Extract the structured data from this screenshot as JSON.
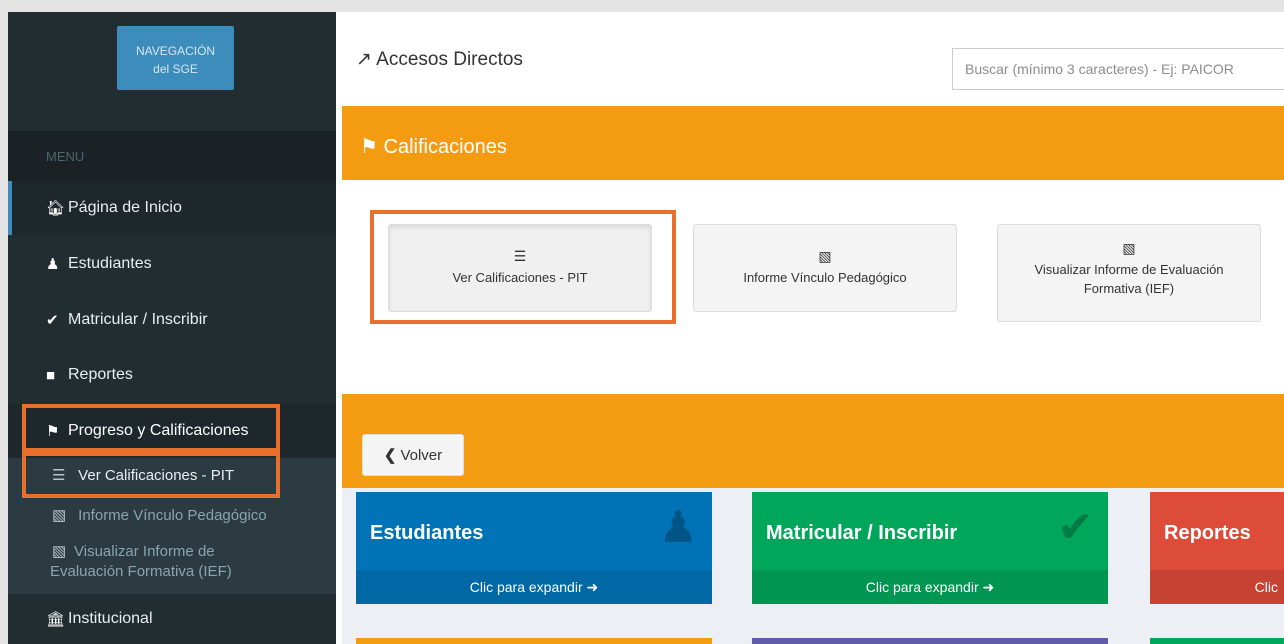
{
  "sidebar": {
    "nav_button": [
      "NAVEGACIÓN",
      "del SGE"
    ],
    "menu_header": "MENU",
    "items": [
      {
        "label": "Página de Inicio",
        "icon": "home-icon"
      },
      {
        "label": "Estudiantes",
        "icon": "person-icon"
      },
      {
        "label": "Matricular / Inscribir",
        "icon": "check-icon"
      },
      {
        "label": "Reportes",
        "icon": "file-icon"
      },
      {
        "label": "Progreso y Calificaciones",
        "icon": "flag-icon"
      },
      {
        "label": "Institucional",
        "icon": "institution-icon"
      }
    ],
    "subitems": [
      {
        "label": "Ver Calificaciones - PIT",
        "icon": "list-icon"
      },
      {
        "label": "Informe Vínculo Pedagógico",
        "icon": "book-icon"
      },
      {
        "label_line1": "Visualizar Informe de",
        "label_line2": "Evaluación Formativa (IEF)",
        "icon": "book-icon"
      }
    ]
  },
  "header": {
    "title": "Accesos Directos",
    "search_placeholder": "Buscar (mínimo 3 caracteres) - Ej: PAICOR"
  },
  "calificaciones": {
    "title": "Calificaciones",
    "shortcuts": [
      {
        "label": "Ver Calificaciones - PIT",
        "icon": "list-icon"
      },
      {
        "label": "Informe Vínculo Pedagógico",
        "icon": "book-icon"
      },
      {
        "label_line1": "Visualizar Informe de Evaluación",
        "label_line2": "Formativa (IEF)",
        "icon": "book-icon"
      }
    ]
  },
  "back_button": "Volver",
  "boxes": [
    {
      "title": "Estudiantes",
      "footer": "Clic para expandir",
      "color": "#0073b7",
      "foot_color": "#0068a5"
    },
    {
      "title": "Matricular / Inscribir",
      "footer": "Clic para expandir",
      "color": "#00a65a",
      "foot_color": "#009551"
    },
    {
      "title": "Reportes",
      "footer": "Clic",
      "color": "#dd4b39",
      "foot_color": "#c64333"
    }
  ],
  "colors": {
    "accent": "#f39c12",
    "highlight": "#e8702a",
    "sidebar": "#222d32"
  }
}
